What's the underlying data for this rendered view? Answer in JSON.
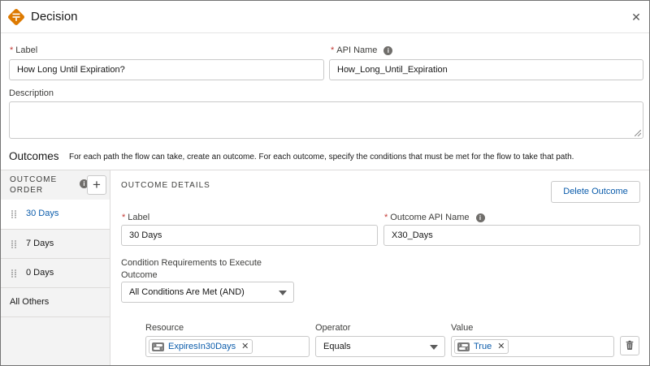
{
  "header": {
    "title": "Decision",
    "close_icon": "close-icon",
    "app_icon": "decision-icon",
    "accent_color": "#dd7a01"
  },
  "label_field": {
    "label": "Label",
    "value": "How Long Until Expiration?"
  },
  "api_name_field": {
    "label": "API Name",
    "value": "How_Long_Until_Expiration"
  },
  "description_field": {
    "label": "Description",
    "value": ""
  },
  "outcomes": {
    "title": "Outcomes",
    "description": "For each path the flow can take, create an outcome. For each outcome, specify the conditions that must be met for the flow to take that path."
  },
  "sidebar": {
    "header_line1": "OUTCOME",
    "header_line2": "ORDER",
    "add_label": "+",
    "items": [
      {
        "label": "30 Days",
        "active": true
      },
      {
        "label": "7 Days",
        "active": false
      },
      {
        "label": "0 Days",
        "active": false
      },
      {
        "label": "All Others",
        "active": false
      }
    ]
  },
  "outcome_details": {
    "title": "OUTCOME DETAILS",
    "delete_label": "Delete Outcome",
    "label_field": {
      "label": "Label",
      "value": "30 Days"
    },
    "api_name_field": {
      "label": "Outcome API Name",
      "value": "X30_Days"
    },
    "condition_requirements": {
      "label_line1": "Condition Requirements to Execute",
      "label_line2": "Outcome",
      "selected": "All Conditions Are Met (AND)"
    },
    "condition": {
      "resource_label": "Resource",
      "resource_value": "ExpiresIn30Days",
      "operator_label": "Operator",
      "operator_value": "Equals",
      "value_label": "Value",
      "value_value": "True"
    }
  },
  "colors": {
    "link": "#0b5cab",
    "required": "#c23934",
    "border": "#c9c9c9"
  }
}
